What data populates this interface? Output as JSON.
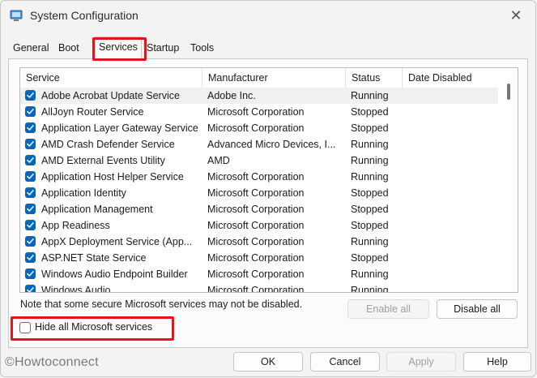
{
  "window": {
    "title": "System Configuration"
  },
  "tabs": [
    {
      "label": "General"
    },
    {
      "label": "Boot"
    },
    {
      "label": "Services"
    },
    {
      "label": "Startup"
    },
    {
      "label": "Tools"
    }
  ],
  "columns": [
    "Service",
    "Manufacturer",
    "Status",
    "Date Disabled"
  ],
  "services": [
    {
      "name": "Adobe Acrobat Update Service",
      "manufacturer": "Adobe Inc.",
      "status": "Running",
      "date_disabled": ""
    },
    {
      "name": "AllJoyn Router Service",
      "manufacturer": "Microsoft Corporation",
      "status": "Stopped",
      "date_disabled": ""
    },
    {
      "name": "Application Layer Gateway Service",
      "manufacturer": "Microsoft Corporation",
      "status": "Stopped",
      "date_disabled": ""
    },
    {
      "name": "AMD Crash Defender Service",
      "manufacturer": "Advanced Micro Devices, I...",
      "status": "Running",
      "date_disabled": ""
    },
    {
      "name": "AMD External Events Utility",
      "manufacturer": "AMD",
      "status": "Running",
      "date_disabled": ""
    },
    {
      "name": "Application Host Helper Service",
      "manufacturer": "Microsoft Corporation",
      "status": "Running",
      "date_disabled": ""
    },
    {
      "name": "Application Identity",
      "manufacturer": "Microsoft Corporation",
      "status": "Stopped",
      "date_disabled": ""
    },
    {
      "name": "Application Management",
      "manufacturer": "Microsoft Corporation",
      "status": "Stopped",
      "date_disabled": ""
    },
    {
      "name": "App Readiness",
      "manufacturer": "Microsoft Corporation",
      "status": "Stopped",
      "date_disabled": ""
    },
    {
      "name": "AppX Deployment Service (App...",
      "manufacturer": "Microsoft Corporation",
      "status": "Running",
      "date_disabled": ""
    },
    {
      "name": "ASP.NET State Service",
      "manufacturer": "Microsoft Corporation",
      "status": "Stopped",
      "date_disabled": ""
    },
    {
      "name": "Windows Audio Endpoint Builder",
      "manufacturer": "Microsoft Corporation",
      "status": "Running",
      "date_disabled": ""
    },
    {
      "name": "Windows Audio",
      "manufacturer": "Microsoft Corporation",
      "status": "Running",
      "date_disabled": ""
    }
  ],
  "note": "Note that some secure Microsoft services may not be disabled.",
  "buttons": {
    "enable_all": "Enable all",
    "disable_all": "Disable all",
    "ok": "OK",
    "cancel": "Cancel",
    "apply": "Apply",
    "help": "Help"
  },
  "hide_ms": {
    "label": "Hide all Microsoft services",
    "checked": false
  },
  "watermark": "©Howtoconnect",
  "colors": {
    "accent": "#0067c0",
    "highlight": "#e2141c"
  },
  "icons": {
    "app": "msconfig-icon",
    "close": "close-icon",
    "check": "checkmark-icon"
  }
}
